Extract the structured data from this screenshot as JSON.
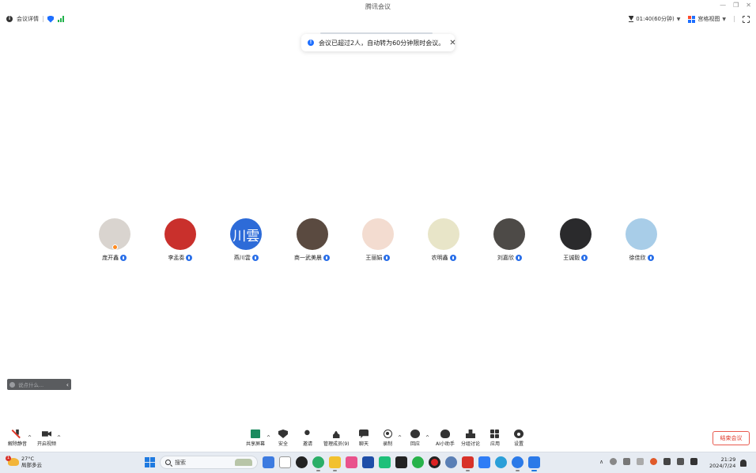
{
  "window": {
    "title": "腾讯会议",
    "controls": [
      "—",
      "❐",
      "✕"
    ]
  },
  "topbar": {
    "meeting_details": "会议详情",
    "timer": "01:40(60分钟)",
    "view_mode": "宫格视图"
  },
  "toast": {
    "message": "会议已超过2人，自动转为60分钟限时会议。",
    "close": "✕"
  },
  "participants": [
    {
      "name": "庞开鑫",
      "avatar_color": "#d9d4cf",
      "host": true
    },
    {
      "name": "李孟奏",
      "avatar_color": "#c9302c",
      "host": false
    },
    {
      "name": "燕川雲",
      "avatar_text": "川雲",
      "avatar_color": "#2d6bd8",
      "host": false
    },
    {
      "name": "商一武美晨",
      "avatar_color": "#5a4a40",
      "host": false
    },
    {
      "name": "王丽娟",
      "avatar_color": "#f3dcd0",
      "host": false
    },
    {
      "name": "农明鑫",
      "avatar_color": "#e8e5c8",
      "host": false
    },
    {
      "name": "刘嘉欣",
      "avatar_color": "#4d4a47",
      "host": false
    },
    {
      "name": "王诚毅",
      "avatar_color": "#2a2a2c",
      "host": false
    },
    {
      "name": "徐佳欣",
      "avatar_color": "#a8cde8",
      "host": false
    }
  ],
  "chat": {
    "placeholder": "说点什么...",
    "collapse": "‹"
  },
  "toolbar": {
    "unmute": "解除静音",
    "start_video": "开启视频",
    "share_screen": "共享屏幕",
    "security": "安全",
    "invite": "邀请",
    "manage_members": "管理成员(9)",
    "chat": "聊天",
    "record": "录制",
    "reactions": "回应",
    "ai_assistant": "AI小助手",
    "breakout": "分组讨论",
    "apps": "应用",
    "settings": "设置",
    "end_meeting": "结束会议"
  },
  "taskbar": {
    "weather_badge": "1",
    "temperature": "27°C",
    "weather_desc": "局部多云",
    "search_label": "搜索",
    "time": "21:29",
    "date": "2024/7/24"
  },
  "colors": {
    "accent": "#1e6fff",
    "danger": "#e0392b",
    "taskbar_bg": "#e6ebf2"
  }
}
